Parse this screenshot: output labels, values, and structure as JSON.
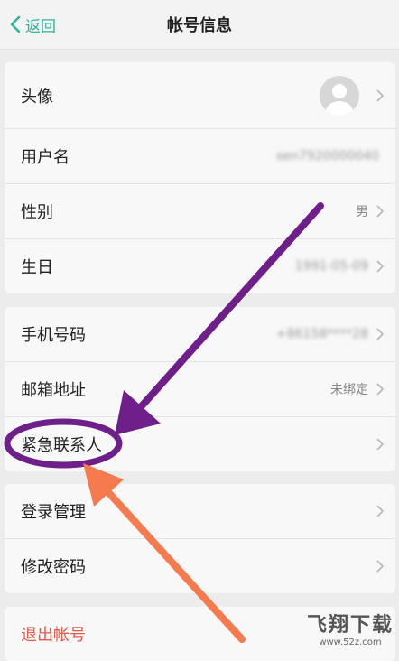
{
  "nav": {
    "back_label": "返回",
    "title": "帐号信息",
    "accent_color": "#2bb59a"
  },
  "profile": {
    "avatar_label": "头像",
    "username_label": "用户名",
    "username_value": "sen7920000040",
    "gender_label": "性别",
    "gender_value": "男",
    "birthday_label": "生日",
    "birthday_value": "1991-05-09"
  },
  "contact": {
    "phone_label": "手机号码",
    "phone_value": "+86158****28",
    "email_label": "邮箱地址",
    "email_value": "未绑定",
    "emergency_label": "紧急联系人"
  },
  "security": {
    "login_label": "登录管理",
    "password_label": "修改密码"
  },
  "logout": {
    "label": "退出帐号",
    "color": "#e45b4e"
  },
  "annotations": {
    "arrow_purple": "#6e1f8a",
    "arrow_orange": "#f57a4d"
  },
  "watermark": {
    "main": "飞翔下载",
    "sub": "www.52z.com"
  }
}
